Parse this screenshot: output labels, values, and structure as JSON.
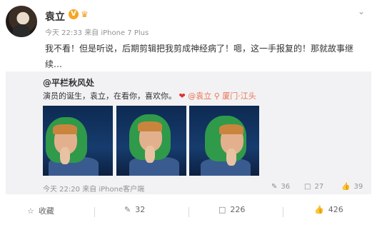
{
  "post": {
    "author": "袁立",
    "time": "今天 22:33",
    "source_prefix": "来自",
    "source": "iPhone 7 Plus",
    "content": "我不看！但是听说，后期剪辑把我剪成神经病了！嗯，这一手报复的！那就故事继续…",
    "more_icon": "chevron-down-icon"
  },
  "repost": {
    "author": "@平栏秋风处",
    "text_main": "演员的诞生，袁立，在看你，喜欢你。",
    "mention": "@袁立",
    "location": "厦门·江头",
    "time": "今天 22:20",
    "source_prefix": "来自",
    "source": "iPhone客户端",
    "reposts": "36",
    "comments": "27",
    "likes": "39"
  },
  "actions": {
    "favorite": "收藏",
    "repost": "32",
    "comment": "226",
    "like": "426"
  },
  "colors": {
    "accent": "#eb7350",
    "heart": "#e0312f",
    "card_bg": "#f2f2f5",
    "badge": "#f5a623"
  }
}
